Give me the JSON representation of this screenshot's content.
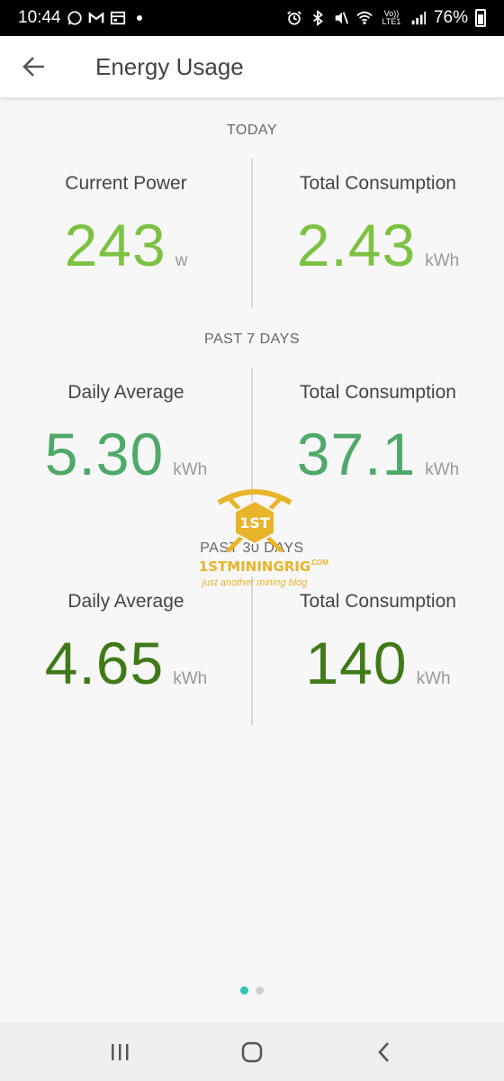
{
  "status_bar": {
    "time": "10:44",
    "network": "Vo)) LTE1",
    "battery": "76%"
  },
  "app_bar": {
    "title": "Energy Usage",
    "back_icon": "arrow-left-icon"
  },
  "sections": {
    "today": {
      "header": "TODAY",
      "left": {
        "label": "Current Power",
        "value": "243",
        "unit": "w"
      },
      "right": {
        "label": "Total Consumption",
        "value": "2.43",
        "unit": "kWh"
      }
    },
    "past7": {
      "header": "PAST 7 DAYS",
      "left": {
        "label": "Daily Average",
        "value": "5.30",
        "unit": "kWh"
      },
      "right": {
        "label": "Total Consumption",
        "value": "37.1",
        "unit": "kWh"
      }
    },
    "past30": {
      "header": "PAST 30 DAYS",
      "left": {
        "label": "Daily Average",
        "value": "4.65",
        "unit": "kWh"
      },
      "right": {
        "label": "Total Consumption",
        "value": "140",
        "unit": "kWh"
      }
    }
  },
  "colors": {
    "today_value": "#7cc242",
    "past7_value": "#4fa96a",
    "past30_value": "#3f7a17",
    "pager_active": "#2ec4b6"
  },
  "watermark": {
    "badge": "1ST",
    "name": "1STMININGRIG",
    "dotcom": ".COM",
    "tagline": "just another mining blog"
  },
  "pager": {
    "pages": 2,
    "active": 1
  },
  "nav_bar": {
    "recent_icon": "recent-apps-icon",
    "home_icon": "home-icon",
    "back_icon": "back-chevron-icon"
  }
}
